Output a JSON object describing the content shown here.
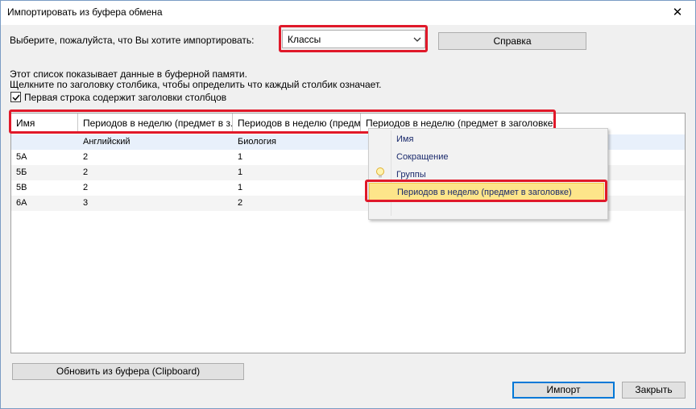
{
  "window": {
    "title": "Импортировать из буфера обмена"
  },
  "import_type": {
    "label": "Выберите, пожалуйста, что Вы хотите импортировать:",
    "selected": "Классы"
  },
  "buttons": {
    "help": "Справка",
    "refresh": "Обновить из буфера (Clipboard)",
    "import": "Импорт",
    "close": "Закрыть"
  },
  "info": {
    "line1": "Этот список показывает данные в буферной памяти.",
    "line2": "Щелкните по заголовку столбика, чтобы определить что каждый столбик означает."
  },
  "first_row_header": {
    "checked": true,
    "label": "Первая строка содержит заголовки столбцов"
  },
  "grid": {
    "columns": [
      "Имя",
      "Периодов в неделю (предмет в з...",
      "Периодов в неделю (предм...",
      "Периодов в неделю (предмет в заголовке)"
    ],
    "rows": [
      [
        "",
        "Английский",
        "Биология",
        ""
      ],
      [
        "5А",
        "2",
        "1",
        ""
      ],
      [
        "5Б",
        "2",
        "1",
        ""
      ],
      [
        "5В",
        "2",
        "1",
        ""
      ],
      [
        "6А",
        "3",
        "2",
        ""
      ]
    ]
  },
  "context_menu": {
    "items": [
      "Имя",
      "Сокращение",
      "Группы",
      "Периодов в неделю (предмет в заголовке)"
    ],
    "active_index": 3
  },
  "colors": {
    "highlight_red": "#e0192a",
    "menu_active": "#fde58a",
    "accent": "#0078d7"
  },
  "icons": {
    "close": "close-icon",
    "dropdown": "chevron-down-icon",
    "checkbox": "checkmark-icon",
    "hint": "lightbulb-icon"
  }
}
